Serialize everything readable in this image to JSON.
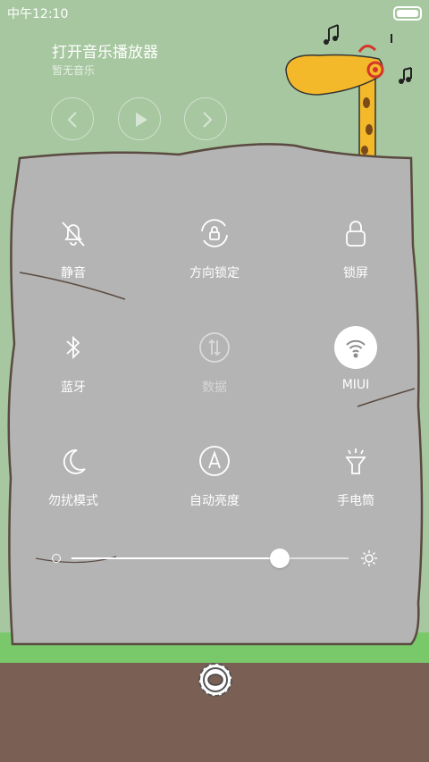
{
  "status_bar": {
    "time": "中午12:10"
  },
  "music": {
    "title": "打开音乐播放器",
    "subtitle": "暂无音乐",
    "controls": [
      "previous-icon",
      "play-icon",
      "next-icon"
    ]
  },
  "toggles": [
    {
      "label": "静音",
      "icon": "bell-off-icon",
      "state": "off"
    },
    {
      "label": "方向锁定",
      "icon": "rotation-lock-icon",
      "state": "off"
    },
    {
      "label": "锁屏",
      "icon": "lock-icon",
      "state": "off"
    },
    {
      "label": "蓝牙",
      "icon": "bluetooth-icon",
      "state": "off"
    },
    {
      "label": "数据",
      "icon": "data-arrows-icon",
      "state": "disabled"
    },
    {
      "label": "MIUI",
      "icon": "wifi-icon",
      "state": "on"
    },
    {
      "label": "勿扰模式",
      "icon": "moon-icon",
      "state": "off"
    },
    {
      "label": "自动亮度",
      "icon": "auto-brightness-icon",
      "state": "off"
    },
    {
      "label": "手电筒",
      "icon": "flashlight-icon",
      "state": "off"
    }
  ],
  "brightness": {
    "level": 0.75
  },
  "colors": {
    "sky": "#a7c7a0",
    "rock": "#b4b4b4",
    "grass": "#79c86a",
    "ground": "#7a5f55",
    "giraffe": "#f4b92a"
  }
}
